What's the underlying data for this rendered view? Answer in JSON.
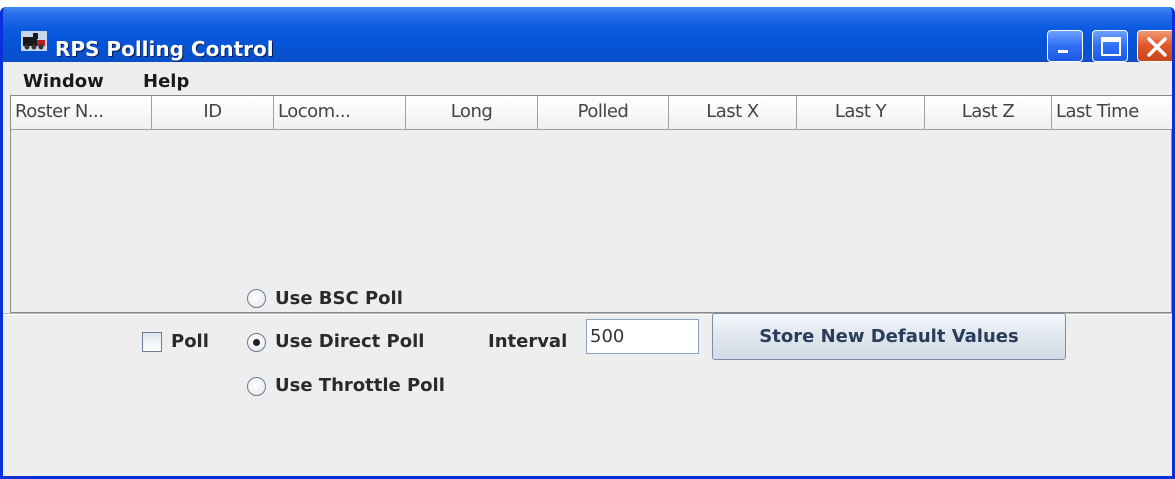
{
  "window": {
    "title": "RPS Polling Control",
    "icon": "railroad-app-icon",
    "controls": [
      "minimize-icon",
      "maximize-icon",
      "close-icon"
    ]
  },
  "menu": {
    "items": [
      {
        "label": "Window"
      },
      {
        "label": "Help"
      }
    ]
  },
  "table": {
    "columns": [
      {
        "label": "Roster N..."
      },
      {
        "label": "ID"
      },
      {
        "label": "Locom..."
      },
      {
        "label": "Long"
      },
      {
        "label": "Polled"
      },
      {
        "label": "Last X"
      },
      {
        "label": "Last Y"
      },
      {
        "label": "Last Z"
      },
      {
        "label": "Last Time"
      }
    ],
    "rows": []
  },
  "controls": {
    "poll_label": "Poll",
    "poll_checked": false,
    "radio_options": [
      {
        "label": "Use BSC Poll",
        "selected": false
      },
      {
        "label": "Use Direct Poll",
        "selected": true
      },
      {
        "label": "Use Throttle Poll",
        "selected": false
      }
    ],
    "interval_label": "Interval",
    "interval_value": "500",
    "store_button_label": "Store New Default Values"
  }
}
